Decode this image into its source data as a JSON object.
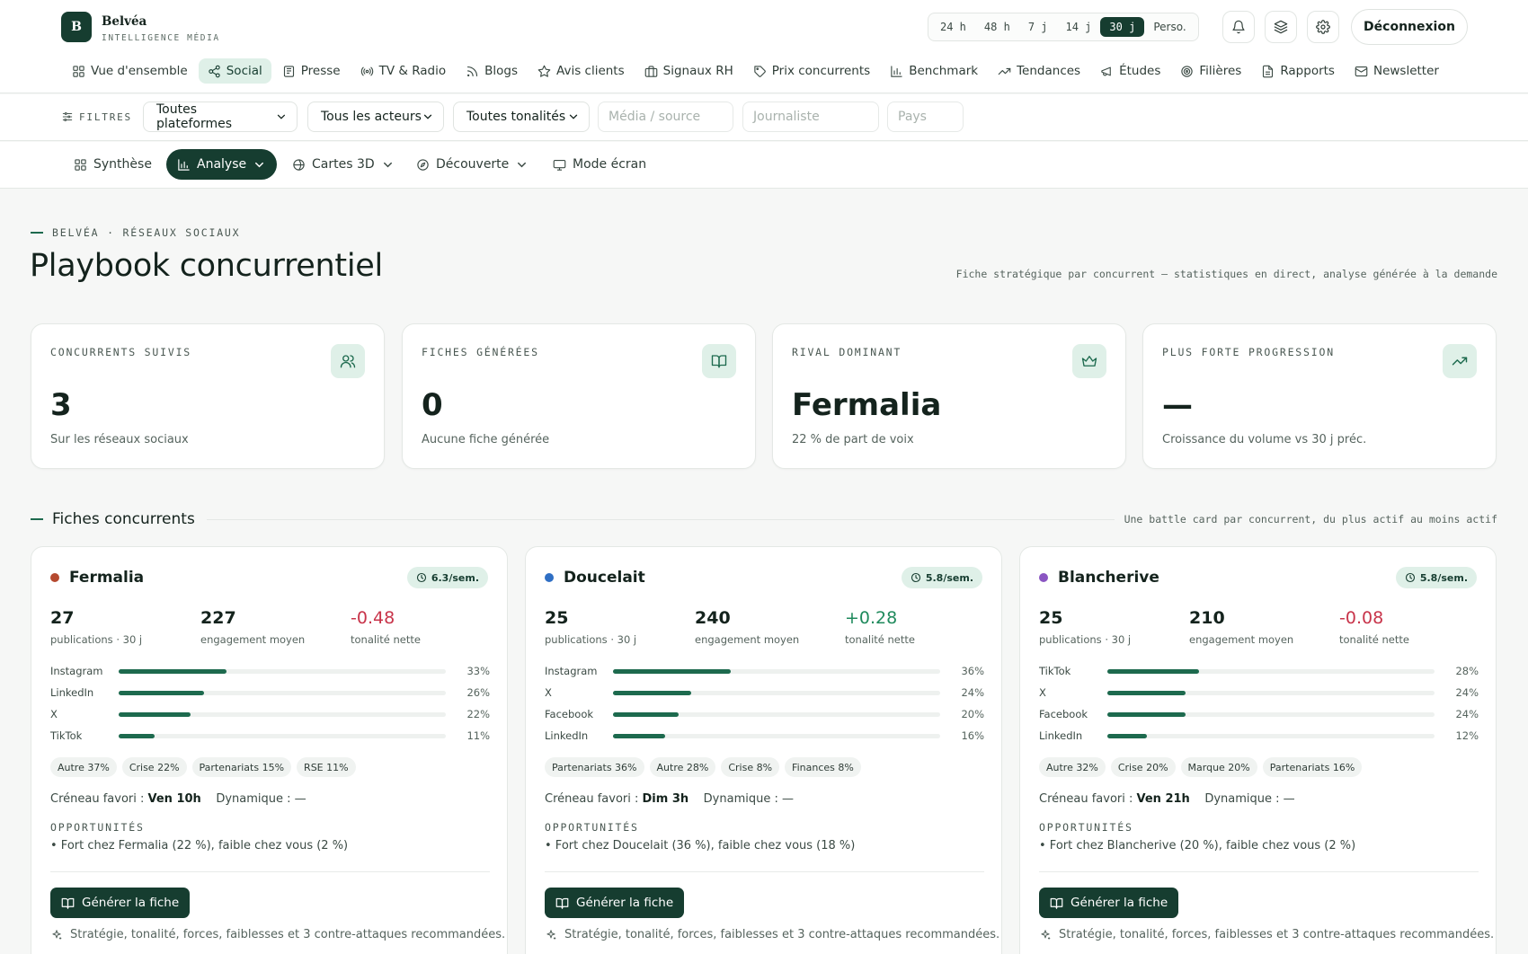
{
  "brand": {
    "logo_letter": "B",
    "name": "Belvéa",
    "subtitle": "INTELLIGENCE MÉDIA"
  },
  "time_ranges": [
    "24 h",
    "48 h",
    "7 j",
    "14 j",
    "30 j",
    "Perso."
  ],
  "active_range": "30 j",
  "header": {
    "logout_label": "Déconnexion"
  },
  "nav": [
    {
      "label": "Vue d'ensemble",
      "icon": "grid-icon"
    },
    {
      "label": "Social",
      "icon": "share-icon",
      "active": true
    },
    {
      "label": "Presse",
      "icon": "newspaper-icon"
    },
    {
      "label": "TV & Radio",
      "icon": "broadcast-icon"
    },
    {
      "label": "Blogs",
      "icon": "rss-icon"
    },
    {
      "label": "Avis clients",
      "icon": "star-icon"
    },
    {
      "label": "Signaux RH",
      "icon": "briefcase-icon"
    },
    {
      "label": "Prix concurrents",
      "icon": "tag-icon"
    },
    {
      "label": "Benchmark",
      "icon": "bar-chart-icon"
    },
    {
      "label": "Tendances",
      "icon": "trend-icon"
    },
    {
      "label": "Études",
      "icon": "megaphone-icon"
    },
    {
      "label": "Filières",
      "icon": "target-icon"
    },
    {
      "label": "Rapports",
      "icon": "file-icon"
    },
    {
      "label": "Newsletter",
      "icon": "mail-icon"
    }
  ],
  "filters": {
    "label": "FILTRES",
    "platforms": "Toutes plateformes",
    "actors": "Tous les acteurs",
    "tones": "Toutes tonalités",
    "media_placeholder": "Média / source",
    "journalist_placeholder": "Journaliste",
    "country_placeholder": "Pays"
  },
  "subnav": {
    "synthese": "Synthèse",
    "analyse": "Analyse",
    "cartes": "Cartes 3D",
    "decouverte": "Découverte",
    "ecran": "Mode écran"
  },
  "page": {
    "eyebrow": "BELVÉA · RÉSEAUX SOCIAUX",
    "title": "Playbook concurrentiel",
    "description": "Fiche stratégique par concurrent — statistiques en direct, analyse générée à la demande"
  },
  "kpis": [
    {
      "label": "CONCURRENTS SUIVIS",
      "value": "3",
      "sub": "Sur les réseaux sociaux",
      "icon": "users-icon"
    },
    {
      "label": "FICHES GÉNÉRÉES",
      "value": "0",
      "sub": "Aucune fiche générée",
      "icon": "book-icon"
    },
    {
      "label": "RIVAL DOMINANT",
      "value": "Fermalia",
      "sub": "22 % de part de voix",
      "icon": "crown-icon"
    },
    {
      "label": "PLUS FORTE PROGRESSION",
      "value": "—",
      "sub": "Croissance du volume vs 30 j préc.",
      "icon": "trend-up-icon"
    }
  ],
  "section": {
    "title": "Fiches concurrents",
    "description": "Une battle card par concurrent, du plus actif au moins actif"
  },
  "labels": {
    "publications": "publications · 30 j",
    "engagement": "engagement moyen",
    "tone": "tonalité nette",
    "slot": "Créneau favori :",
    "dynamics": "Dynamique :",
    "opportunities": "OPPORTUNITÉS",
    "generate": "Générer la fiche",
    "generate_note": "Stratégie, tonalité, forces, faiblesses et 3 contre-attaques recommandées."
  },
  "competitors": [
    {
      "name": "Fermalia",
      "color": "#b5492f",
      "freq": "6.3/sem.",
      "publications": "27",
      "engagement": "227",
      "tone": "-0.48",
      "tone_sign": "neg",
      "platforms": [
        {
          "name": "Instagram",
          "pct": 33,
          "label": "33%"
        },
        {
          "name": "LinkedIn",
          "pct": 26,
          "label": "26%"
        },
        {
          "name": "X",
          "pct": 22,
          "label": "22%"
        },
        {
          "name": "TikTok",
          "pct": 11,
          "label": "11%"
        }
      ],
      "tags": [
        "Autre 37%",
        "Crise 22%",
        "Partenariats 15%",
        "RSE 11%"
      ],
      "slot": "Ven 10h",
      "dynamics": "—",
      "opportunity": "• Fort chez Fermalia (22 %), faible chez vous (2 %)"
    },
    {
      "name": "Doucelait",
      "color": "#2f6fc4",
      "freq": "5.8/sem.",
      "publications": "25",
      "engagement": "240",
      "tone": "+0.28",
      "tone_sign": "pos",
      "platforms": [
        {
          "name": "Instagram",
          "pct": 36,
          "label": "36%"
        },
        {
          "name": "X",
          "pct": 24,
          "label": "24%"
        },
        {
          "name": "Facebook",
          "pct": 20,
          "label": "20%"
        },
        {
          "name": "LinkedIn",
          "pct": 16,
          "label": "16%"
        }
      ],
      "tags": [
        "Partenariats 36%",
        "Autre 28%",
        "Crise 8%",
        "Finances 8%"
      ],
      "slot": "Dim 3h",
      "dynamics": "—",
      "opportunity": "• Fort chez Doucelait (36 %), faible chez vous (18 %)"
    },
    {
      "name": "Blancherive",
      "color": "#8a55c2",
      "freq": "5.8/sem.",
      "publications": "25",
      "engagement": "210",
      "tone": "-0.08",
      "tone_sign": "neg",
      "platforms": [
        {
          "name": "TikTok",
          "pct": 28,
          "label": "28%"
        },
        {
          "name": "X",
          "pct": 24,
          "label": "24%"
        },
        {
          "name": "Facebook",
          "pct": 24,
          "label": "24%"
        },
        {
          "name": "LinkedIn",
          "pct": 12,
          "label": "12%"
        }
      ],
      "tags": [
        "Autre 32%",
        "Crise 20%",
        "Marque 20%",
        "Partenariats 16%"
      ],
      "slot": "Ven 21h",
      "dynamics": "—",
      "opportunity": "• Fort chez Blancherive (20 %), faible chez vous (2 %)"
    }
  ]
}
